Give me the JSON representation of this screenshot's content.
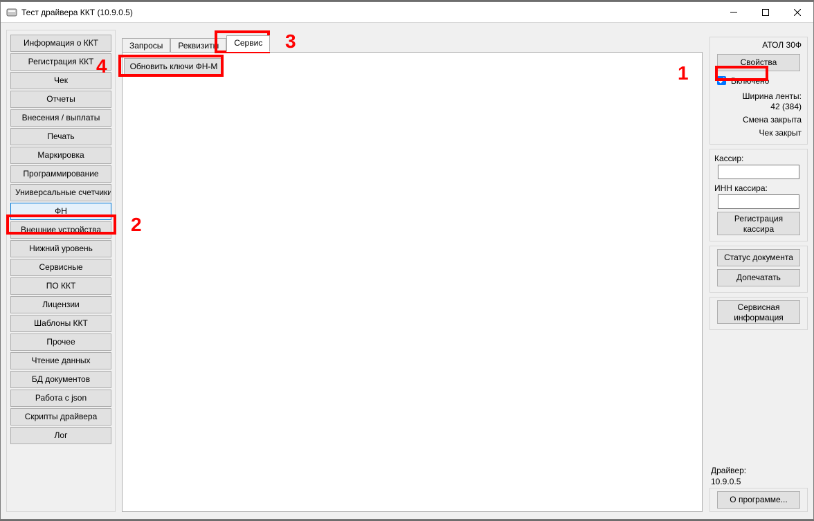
{
  "window": {
    "title": "Тест драйвера ККТ (10.9.0.5)"
  },
  "sidebar": {
    "items": [
      {
        "label": "Информация о ККТ",
        "active": false
      },
      {
        "label": "Регистрация ККТ",
        "active": false
      },
      {
        "label": "Чек",
        "active": false
      },
      {
        "label": "Отчеты",
        "active": false
      },
      {
        "label": "Внесения / выплаты",
        "active": false
      },
      {
        "label": "Печать",
        "active": false
      },
      {
        "label": "Маркировка",
        "active": false
      },
      {
        "label": "Программирование",
        "active": false
      },
      {
        "label": "Универсальные счетчики",
        "active": false
      },
      {
        "label": "ФН",
        "active": true
      },
      {
        "label": "Внешние устройства",
        "active": false
      },
      {
        "label": "Нижний уровень",
        "active": false
      },
      {
        "label": "Сервисные",
        "active": false
      },
      {
        "label": "ПО ККТ",
        "active": false
      },
      {
        "label": "Лицензии",
        "active": false
      },
      {
        "label": "Шаблоны ККТ",
        "active": false
      },
      {
        "label": "Прочее",
        "active": false
      },
      {
        "label": "Чтение данных",
        "active": false
      },
      {
        "label": "БД документов",
        "active": false
      },
      {
        "label": "Работа с json",
        "active": false
      },
      {
        "label": "Скрипты драйвера",
        "active": false
      },
      {
        "label": "Лог",
        "active": false
      }
    ]
  },
  "tabs": {
    "items": [
      {
        "label": "Запросы",
        "active": false
      },
      {
        "label": "Реквизиты",
        "active": false
      },
      {
        "label": "Сервис",
        "active": true
      }
    ],
    "service_button": "Обновить ключи ФН-М"
  },
  "right": {
    "device_name": "АТОЛ 30Ф",
    "properties_btn": "Свойства",
    "enabled_label": "Включено",
    "enabled_checked": true,
    "tape_width_label": "Ширина ленты:",
    "tape_width_value": "42 (384)",
    "shift_status": "Смена закрыта",
    "receipt_status": "Чек закрыт",
    "cashier_label": "Кассир:",
    "cashier_value": "",
    "cashier_inn_label": "ИНН кассира:",
    "cashier_inn_value": "",
    "register_cashier_btn": "Регистрация\nкассира",
    "doc_status_btn": "Статус документа",
    "reprint_btn": "Допечатать",
    "service_info_btn": "Сервисная\nинформация",
    "driver_label": "Драйвер:",
    "driver_version": "10.9.0.5",
    "about_btn": "О программе..."
  },
  "annotations": {
    "n1": "1",
    "n2": "2",
    "n3": "3",
    "n4": "4"
  }
}
